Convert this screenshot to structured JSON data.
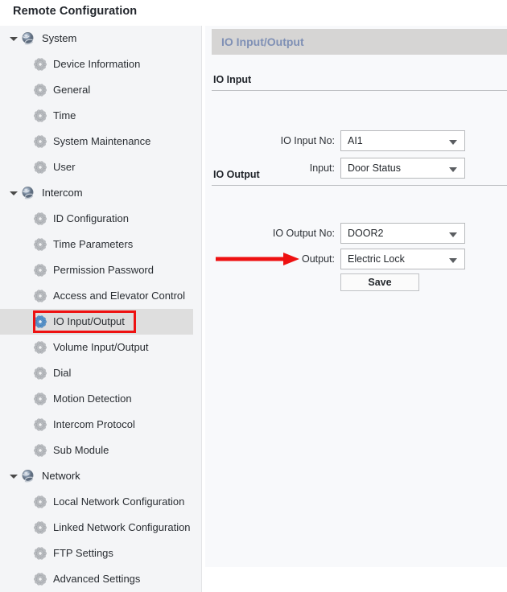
{
  "window": {
    "title": "Remote Configuration"
  },
  "sidebar": {
    "groups": [
      {
        "label": "System",
        "icon": "globe-icon",
        "expanded": true,
        "items": [
          {
            "label": "Device Information",
            "icon": "gear-icon"
          },
          {
            "label": "General",
            "icon": "gear-icon"
          },
          {
            "label": "Time",
            "icon": "gear-icon"
          },
          {
            "label": "System Maintenance",
            "icon": "gear-icon"
          },
          {
            "label": "User",
            "icon": "gear-icon"
          }
        ]
      },
      {
        "label": "Intercom",
        "icon": "globe-icon",
        "expanded": true,
        "items": [
          {
            "label": "ID Configuration",
            "icon": "gear-icon"
          },
          {
            "label": "Time Parameters",
            "icon": "gear-icon"
          },
          {
            "label": "Permission Password",
            "icon": "gear-icon"
          },
          {
            "label": "Access and Elevator Control",
            "icon": "gear-icon"
          },
          {
            "label": "IO Input/Output",
            "icon": "gear-icon",
            "selected": true,
            "annotated": true
          },
          {
            "label": "Volume Input/Output",
            "icon": "gear-icon"
          },
          {
            "label": "Dial",
            "icon": "gear-icon"
          },
          {
            "label": "Motion Detection",
            "icon": "gear-icon"
          },
          {
            "label": "Intercom Protocol",
            "icon": "gear-icon"
          },
          {
            "label": "Sub Module",
            "icon": "gear-icon"
          }
        ]
      },
      {
        "label": "Network",
        "icon": "globe-icon",
        "expanded": true,
        "items": [
          {
            "label": "Local Network Configuration",
            "icon": "gear-icon"
          },
          {
            "label": "Linked Network Configuration",
            "icon": "gear-icon"
          },
          {
            "label": "FTP Settings",
            "icon": "gear-icon"
          },
          {
            "label": "Advanced Settings",
            "icon": "gear-icon"
          }
        ]
      }
    ]
  },
  "panel": {
    "header_title": "IO Input/Output",
    "sections": [
      {
        "title": "IO Input",
        "fields": [
          {
            "label": "IO Input No:",
            "value": "AI1",
            "control": "dropdown"
          },
          {
            "label": "Input:",
            "value": "Door Status",
            "control": "dropdown"
          }
        ]
      },
      {
        "title": "IO Output",
        "fields": [
          {
            "label": "IO Output No:",
            "value": "DOOR2",
            "control": "dropdown"
          },
          {
            "label": "Output:",
            "value": "Electric Lock",
            "control": "dropdown",
            "annotated": true
          }
        ]
      }
    ],
    "save_label": "Save"
  },
  "annotations": {
    "arrow_color": "#ee1111",
    "box_color": "#ee1111"
  }
}
